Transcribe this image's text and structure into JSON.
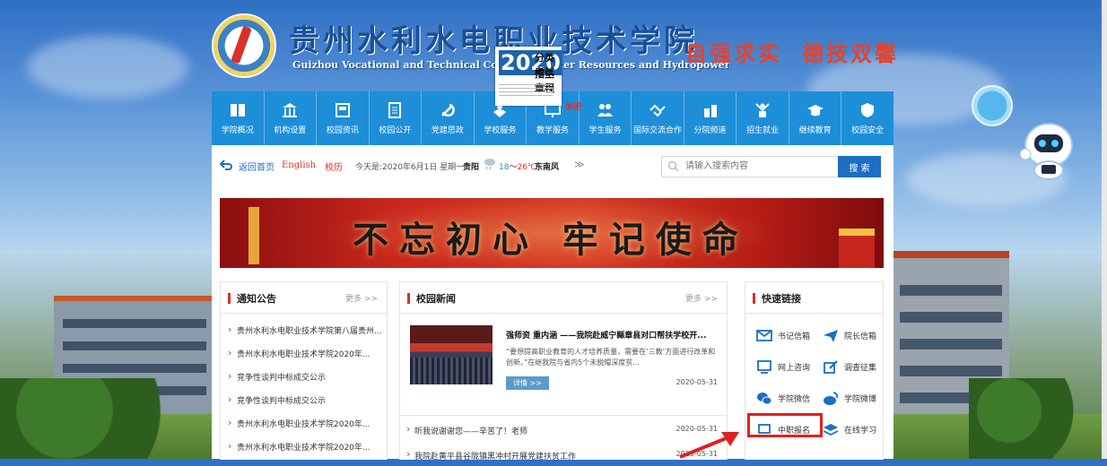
{
  "header": {
    "school_name": "贵州水利水电职业技术学院",
    "school_en": "Guizhou Vocational and Technical College of Water Resources and Hydropower",
    "motto_1": "自强求实",
    "motto_2": "德技双馨"
  },
  "float_ad": {
    "year": "2020",
    "line1": "分类考试",
    "line2": "招生章程",
    "close": "关闭"
  },
  "nav": {
    "items": [
      {
        "label": "学院概况",
        "icon": "book-icon"
      },
      {
        "label": "机构设置",
        "icon": "building-columns-icon"
      },
      {
        "label": "校园资讯",
        "icon": "news-icon"
      },
      {
        "label": "校园公开",
        "icon": "document-icon"
      },
      {
        "label": "党建思政",
        "icon": "party-emblem-icon"
      },
      {
        "label": "学校服务",
        "icon": "hands-icon"
      },
      {
        "label": "教学服务",
        "icon": "screen-icon"
      },
      {
        "label": "学生服务",
        "icon": "students-icon"
      },
      {
        "label": "国际交流合作",
        "icon": "handshake-icon"
      },
      {
        "label": "分院频道",
        "icon": "campus-icon"
      },
      {
        "label": "招生就业",
        "icon": "cheering-icon"
      },
      {
        "label": "继续教育",
        "icon": "graduation-cap-icon"
      },
      {
        "label": "校园安全",
        "icon": "shield-icon"
      }
    ]
  },
  "toolbar": {
    "home": "返回首页",
    "english": "English",
    "calendar": "校历",
    "date": "今天是:2020年6月1日 星期一",
    "city": "贵阳",
    "temp_low": "18",
    "temp_sep": "～",
    "temp_high": "26℃",
    "wind": "东南风",
    "more": "≫",
    "search_placeholder": "请输入搜索内容",
    "search_button": "搜 索"
  },
  "banner": {
    "slogan": "不忘初心 牢记使命"
  },
  "notice": {
    "title": "通知公告",
    "more": "更多 >>",
    "items": [
      "贵州水利水电职业技术学院第八届贵州...",
      "贵州水利水电职业技术学院2020年...",
      "竞争性谈判中标成交公示",
      "竞争性谈判中标成交公示",
      "贵州水利水电职业技术学院2020年...",
      "贵州水利水电职业技术学院2020年..."
    ]
  },
  "news": {
    "title": "校园新闻",
    "more": "更多 >>",
    "featured": {
      "title": "强师资 重内涵 ——我院赴威宁縣章县对口帮扶学校开...",
      "summary": "“要想提高职业教育的人才培养质量，需要在‘三教’方面进行改革和创新。”在继我院与省内5个未脱帽深度贫...",
      "button": "详情 >>",
      "date": "2020-05-31"
    },
    "items": [
      {
        "title": "听我说谢谢您——辛苦了！老师",
        "date": "2020-05-31"
      },
      {
        "title": "我院赴黄平县谷陇镇黑冲村开展党建扶贫工作",
        "date": "2020-05-31"
      }
    ]
  },
  "quick": {
    "title": "快速链接",
    "items": [
      {
        "label": "书记信箱",
        "icon": "mail-icon",
        "color": "#1d6ec4"
      },
      {
        "label": "院长信箱",
        "icon": "mail-plane-icon",
        "color": "#1d6ec4"
      },
      {
        "label": "网上咨询",
        "icon": "monitor-icon",
        "color": "#1d6ec4"
      },
      {
        "label": "调查征集",
        "icon": "edit-icon",
        "color": "#1d6ec4"
      },
      {
        "label": "学院微信",
        "icon": "wechat-icon",
        "color": "#1d6ec4"
      },
      {
        "label": "学院微博",
        "icon": "weibo-icon",
        "color": "#1d6ec4"
      },
      {
        "label": "中职报名",
        "icon": "laptop-icon",
        "color": "#1d6ec4"
      },
      {
        "label": "在线学习",
        "icon": "layers-icon",
        "color": "#1d6ec4"
      }
    ]
  },
  "colors": {
    "nav_blue": "#1d8ed8",
    "accent_red": "#d9302b",
    "highlight_red": "#e02020",
    "link_blue": "#1d6ec4"
  }
}
